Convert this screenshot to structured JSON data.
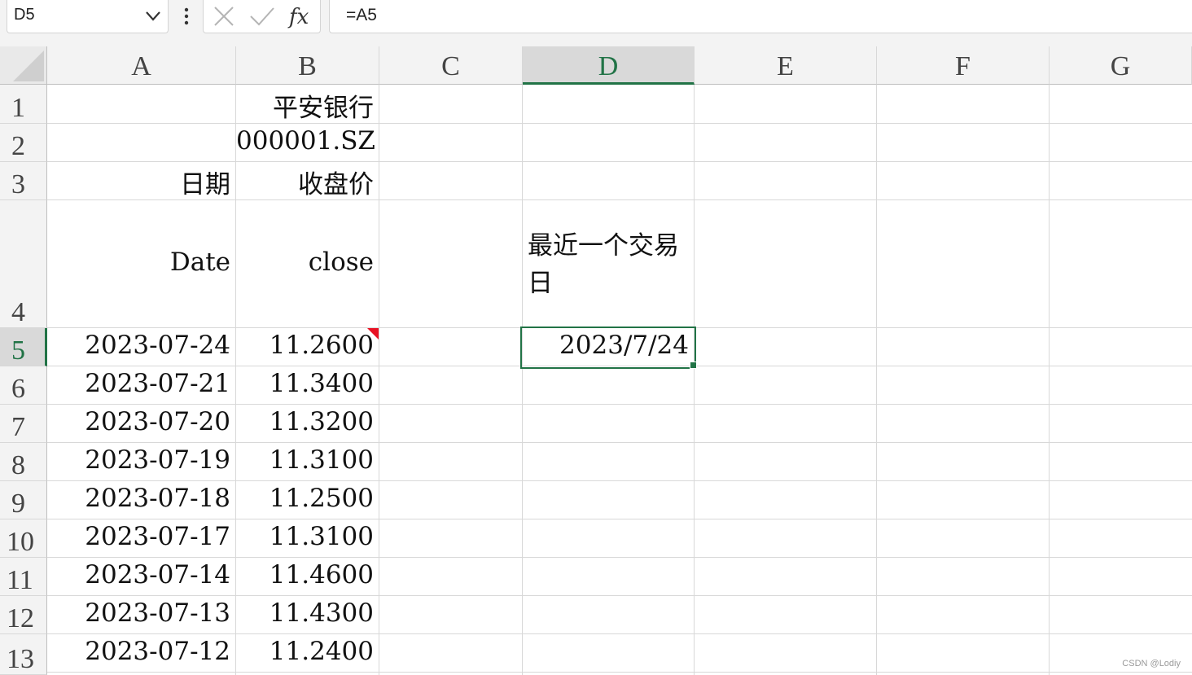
{
  "formula_bar": {
    "name_box": "D5",
    "formula": "=A5"
  },
  "columns": [
    "A",
    "B",
    "C",
    "D",
    "E",
    "F",
    "G"
  ],
  "rows": [
    "1",
    "2",
    "3",
    "4",
    "5",
    "6",
    "7",
    "8",
    "9",
    "10",
    "11",
    "12",
    "13"
  ],
  "cells": {
    "B1": "平安银行",
    "B2": "000001.SZ",
    "A3": "日期",
    "B3": "收盘价",
    "A4": "Date",
    "B4": "close",
    "D4": "最近一个交易日",
    "D5": "2023/7/24"
  },
  "data_rows": [
    {
      "date": "2023-07-24",
      "close": "11.2600"
    },
    {
      "date": "2023-07-21",
      "close": "11.3400"
    },
    {
      "date": "2023-07-20",
      "close": "11.3200"
    },
    {
      "date": "2023-07-19",
      "close": "11.3100"
    },
    {
      "date": "2023-07-18",
      "close": "11.2500"
    },
    {
      "date": "2023-07-17",
      "close": "11.3100"
    },
    {
      "date": "2023-07-14",
      "close": "11.4600"
    },
    {
      "date": "2023-07-13",
      "close": "11.4300"
    },
    {
      "date": "2023-07-12",
      "close": "11.2400"
    }
  ],
  "selected_cell": "D5",
  "colors": {
    "accent": "#217346",
    "comment_marker": "#e81123"
  },
  "watermark": "CSDN @Lodiy"
}
